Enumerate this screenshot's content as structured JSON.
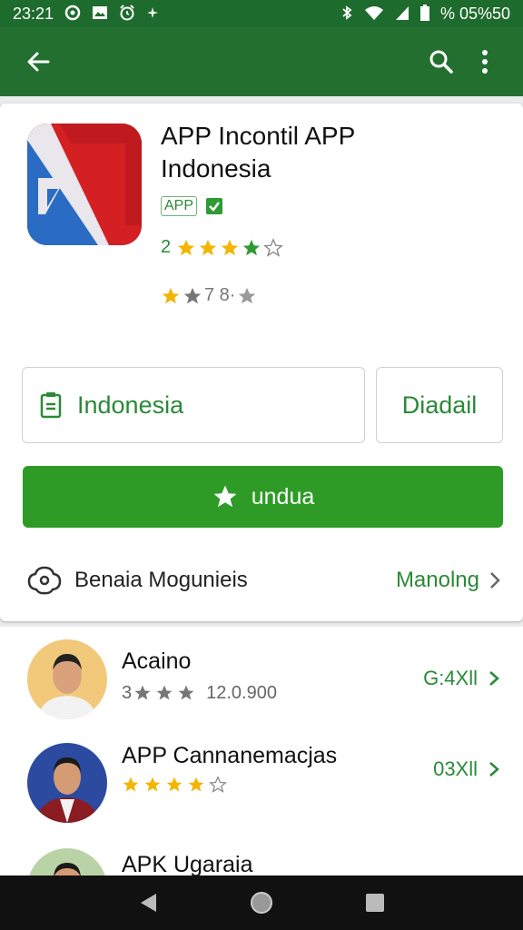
{
  "status_bar": {
    "time": "23:21",
    "icons_left": [
      "notification-icon",
      "image-icon",
      "alarm-icon",
      "star-icon"
    ],
    "battery": "% 05%50",
    "icons_right": [
      "bluetooth-icon",
      "wifi-icon",
      "signal-icon",
      "battery-icon"
    ]
  },
  "toolbar": {
    "back_icon": "arrow-back-icon",
    "search_icon": "search-icon",
    "menu_icon": "more-vert-icon"
  },
  "app": {
    "title_line1": "APP Incontil APP",
    "title_line2": "Indonesia",
    "tag": "APP",
    "rating_text": "2",
    "rating_stars": 4,
    "rating2_text": "7 8·",
    "brand_colors": {
      "red": "#cf1f24",
      "blue": "#2a6bc4",
      "green": "#2e9b26",
      "dark_green": "#226f30"
    }
  },
  "buttons": {
    "region_label": "Indonesia",
    "detail_label": "Diadail",
    "install_label": "undua"
  },
  "developer": {
    "name": "Benaia Mogunieis",
    "more_label": "Manolng"
  },
  "related_apps": [
    {
      "name": "Acaino",
      "stars_label": "3",
      "downloads": "12.0.900",
      "size": "G:4Xll",
      "rating": 3
    },
    {
      "name": "APP Cannanemacjas",
      "size": "03Xll",
      "rating": 4
    },
    {
      "name": "APK Ugaraia",
      "size": ""
    }
  ]
}
